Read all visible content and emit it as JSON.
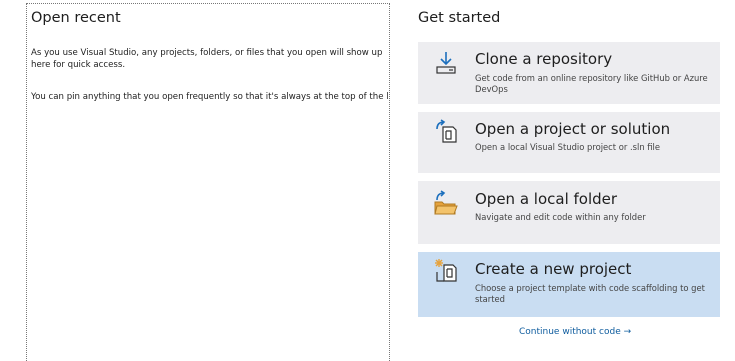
{
  "open_recent": {
    "title": "Open recent",
    "paragraph1": "As you use Visual Studio, any projects, folders, or files that you open will show up here for quick access.",
    "paragraph2": "You can pin anything that you open frequently so that it's always at the top of the list."
  },
  "get_started": {
    "title": "Get started",
    "cards": [
      {
        "title": "Clone a repository",
        "description": "Get code from an online repository like GitHub or Azure DevOps",
        "icon": "download-icon"
      },
      {
        "title": "Open a project or solution",
        "description": "Open a local Visual Studio project or .sln file",
        "icon": "open-project-icon"
      },
      {
        "title": "Open a local folder",
        "description": "Navigate and edit code within any folder",
        "icon": "open-folder-icon"
      },
      {
        "title": "Create a new project",
        "description": "Choose a project template with code scaffolding to get started",
        "icon": "new-project-icon",
        "selected": true
      }
    ],
    "continue_label": "Continue without code →"
  },
  "colors": {
    "card_bg": "#ededf0",
    "card_selected_bg": "#c9ddf2",
    "accent_blue": "#1c6fbd",
    "folder_orange": "#e6a23c",
    "link_blue": "#0e5c9e"
  }
}
